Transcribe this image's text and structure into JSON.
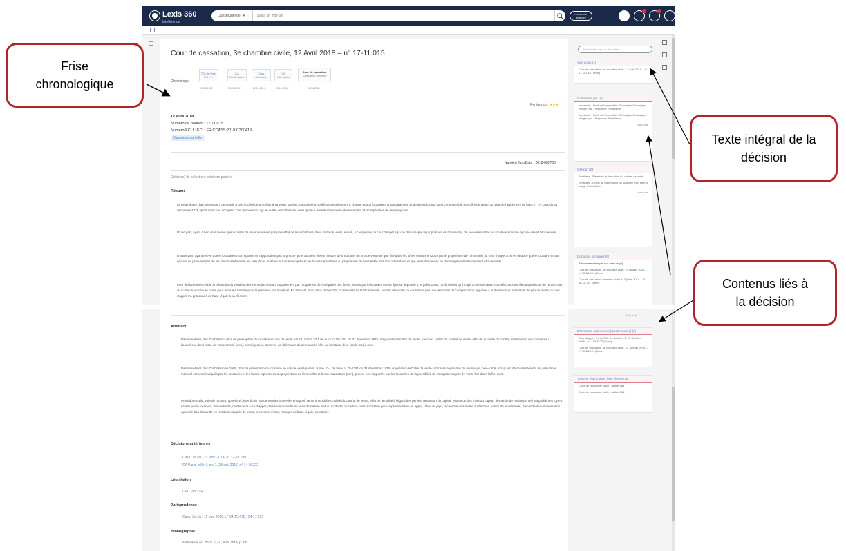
{
  "appbar": {
    "brand": "Lexis 360",
    "brand_sub": "Intelligence",
    "search_scope": "Jurisprudence",
    "search_placeholder": "Saisir un mot-clé",
    "advanced_label": "recherche avancée"
  },
  "document": {
    "title": "Cour de cassation, 3e chambre civile, 12 Avril 2018 – n° 17-11.015",
    "chronology_label": "Chronologie",
    "chronology": [
      {
        "label": "TGI de Paris",
        "sub": "RG n°...",
        "date": "09/12/2010"
      },
      {
        "label": "CA",
        "sub": "Confirmation",
        "date": "15/06/2012"
      },
      {
        "label": "Cass.",
        "sub": "Cassation",
        "date": "22/01/2014"
      },
      {
        "label": "CA",
        "sub": "Infirmation",
        "date": "28/10/2016"
      },
      {
        "label": "Cour de cassation",
        "sub": "Cassation partielle",
        "date": "12/04/2018"
      }
    ],
    "pertinence_label": "Pertinence :",
    "pertinence_stars": "★★★☆",
    "date": "12 Avril 2018",
    "pourvoi": "Numéro de pourvoi : 17-11.015",
    "ecli": "Numéro ECLI : ECLI:FR:CCASS:2018:C300419",
    "tag": "Cassation partielle",
    "juridata": "Numéro JurisData : 2018-005700",
    "criteria": "Critère(s) de sélection : décision publiée",
    "resume_heading": "Résumé",
    "resume": [
      "Le propriétaire d'un immeuble a demandé à une société de procéder à sa vente par lots. La société a notifié successivement à chaque époux locataire d'un appartement et de divers locaux dans cet immeuble une offre de vente, au visa de l'article 10-I de la loi n° 75-1351 du 31 décembre 1975, qu'ils n'ont pas acceptée. Ces derniers ont agi en nullité des offres de vente qui leur ont été adressées ultérieurement et en réparation de leur préjudice.",
      "D'une part, ayant à bon droit retenu que la nullité de la vente n'avait pas pour effet de les substituer, dans l'acte de vente annulé, à l'acquéreur, la cour d'appel a pu en déduire que le propriétaire de l'immeuble, de nouvelles offres au locataire et à son épouse devait être rejetée.",
      "D'autre part, ayant relevé que le locataire et son épouse ne rapportaient pas la preuve qu'ils auraient été en mesure de s'acquitter du prix de vente tel que fixé dans les offres émises en 2005 par le propriétaire de l'immeuble, la cour d'appel a pu en déduire que le locataire et son épouse ne prouvant pas de lien de causalité entre les préjudices matériel et moral invoqués et les fautes reprochées au propriétaire de l'immeuble et à son mandataire et que leurs demandes en dommages-intérêts devaient être rejetées.",
      "Pour déclarer irrecevable la demande du vendeur de l'immeuble tendant au paiement par l'acquéreur de l'intégralité des loyers versés par le locataire et son épouse depuis le 1 er juillet 2005, l'arrêt retient qu'il s'agit d'une demande nouvelle, au sens des dispositions de l'article 564 du Code de procédure civile, pour avoir été formée pour la première fois en appel. En statuant ainsi, sans rechercher, comme il le lui était demandé, si cette demande ne constituait pas une demande de compensation opposée à la demande en restitution du prix de vente, la cour d'appel n'a pas donné de base légale à sa décision."
    ],
    "abstract_heading": "Abstract",
    "abstract": [
      "Bail immobilier, bail d'habitation, droit de préemption du locataire en cas de vente par lot, article 10-1 de la loi n° 75-1351 du 31 décembre 1975, irrégularité de l'offre de vente, sanction, nullité du contrat de vente, effet de la nullité du contrat, substitution des locataires à l'acquéreur dans l'acte de vente annulé (non), conséquence, absence de délivrance d'une nouvelle offre au locataire, bien-fondé (non), rejet.",
      "Bail immobilier, bail d'habitation loi 1989, droit de préemption du locataire en cas de vente par lot, article 10-1 de la loi n° 75-1351 du 31 décembre 1975, irrégularité de l'offre de vente, action en réparation du dommage, bien-fondé (non), lien de causalité entre les préjudices matériel et moral invoqués par les locataires et les fautes reprochées au propriétaire de l'immeuble et à son mandataire (non), preuve non rapportée par les locataires de la possibilité de s'acquitter du prix de vente fixé dans l'offre, rejet.",
      "Procédure civile, voie de recours, appel civil, interdiction de demandes nouvelles en appel, vente immobilière, nullité du contrat de vente, effet de la nullité à l'égard des parties, restitution du capital, restitution des fruits du capital, demande de restitution de l'intégralité des loyers versés par le locataire, irrecevabilité, motifs de la cour d'appel, demande nouvelle au sens de l'article 564 du Code de procédure civile, formation pour la première fois en appel, office du juge, recherche demandée à effectuer, nature de la demande, demande de compensation opposée à la demande en restitution du prix de vente, recherche omise, manque de base légale, cassation."
    ],
    "prior_heading": "Décisions antérieures",
    "prior_links": [
      "Cass. 3e civ., 22 janv. 2014, n° 12-28.099",
      "CA Paris, pôle 4, ch. 1, 28 oct. 2016, n° 14-03222"
    ],
    "legislation_heading": "Législation",
    "legislation_links": [
      "CPC, art. 564"
    ],
    "jurisprudence_heading": "Jurisprudence",
    "jurisprudence_links": [
      "Cass. 3e civ., 11 nov. 2006, n° 04-15.678 ; 04-17.229"
    ],
    "biblio_heading": "Bibliographie",
    "biblio_text": "Administrer oct. 2018, p. 44 ; AJDI 2019, p. 232"
  },
  "right_column": {
    "search_placeholder": "Rechercher dans le document",
    "boxes": [
      {
        "heading": "Vise aussi (1)",
        "items": [
          "Cour de cassation, 3e chambre civile, 12 Avril 2018 – n° 17-11.015 (Texte)"
        ],
        "more": ""
      },
      {
        "heading": "Commenté par (2)",
        "items": [
          "Immeuble - Droit de l'immeuble - Chronique Chronique rédigée par : Stéphane Piédelièvre",
          "Immeuble - Droit de l'immeuble - Chronique Chronique rédigée par : Stéphane Piédelièvre"
        ],
        "more": "Voir tout"
      },
      {
        "heading": "Cité par (22)",
        "items": [
          "Synthèse - Éléments et formation du contrat de vente",
          "Synthèse - Droits de préemption du locataire d'un bien à usage d'habitation"
        ],
        "more": "Voir tout"
      },
      {
        "heading": "Décisions similaires (6)",
        "items": [
          "Recommandées par nos auteurs (6)",
          "Cour de cassation, 3e chambre civile, 22 janvier 2014 – n° 12-28.099 (Texte)",
          "Cour de cassation, chambre civile 3, 3 juillet 2019 – n° 18-11.191 (Arrêt)"
        ],
        "more": "Voir tout"
      },
      {
        "heading": "Décision(s) antérieure(s)/postérieure(s) (2)",
        "items": [
          "Cour d'appel, Paris, Pôle 4, chambre 1, 28 Octobre 2016 – n° 14/03222 (Texte)",
          "Cour de cassation, 3e chambre civile, 22 Janvier 2014 – n° 12-28.099 (Texte)"
        ],
        "more": ""
      },
      {
        "heading": "Texte(s) visé(s) dans le(s) résumé (2)",
        "items": [
          "Code de procédure civile - Article 564",
          "Code de procédure civile - Article 564"
        ],
        "more": ""
      }
    ]
  },
  "callouts": {
    "frise": "Frise chronologique",
    "texte": "Texte intégral de la décision",
    "contenus": "Contenus liés à la décision"
  }
}
